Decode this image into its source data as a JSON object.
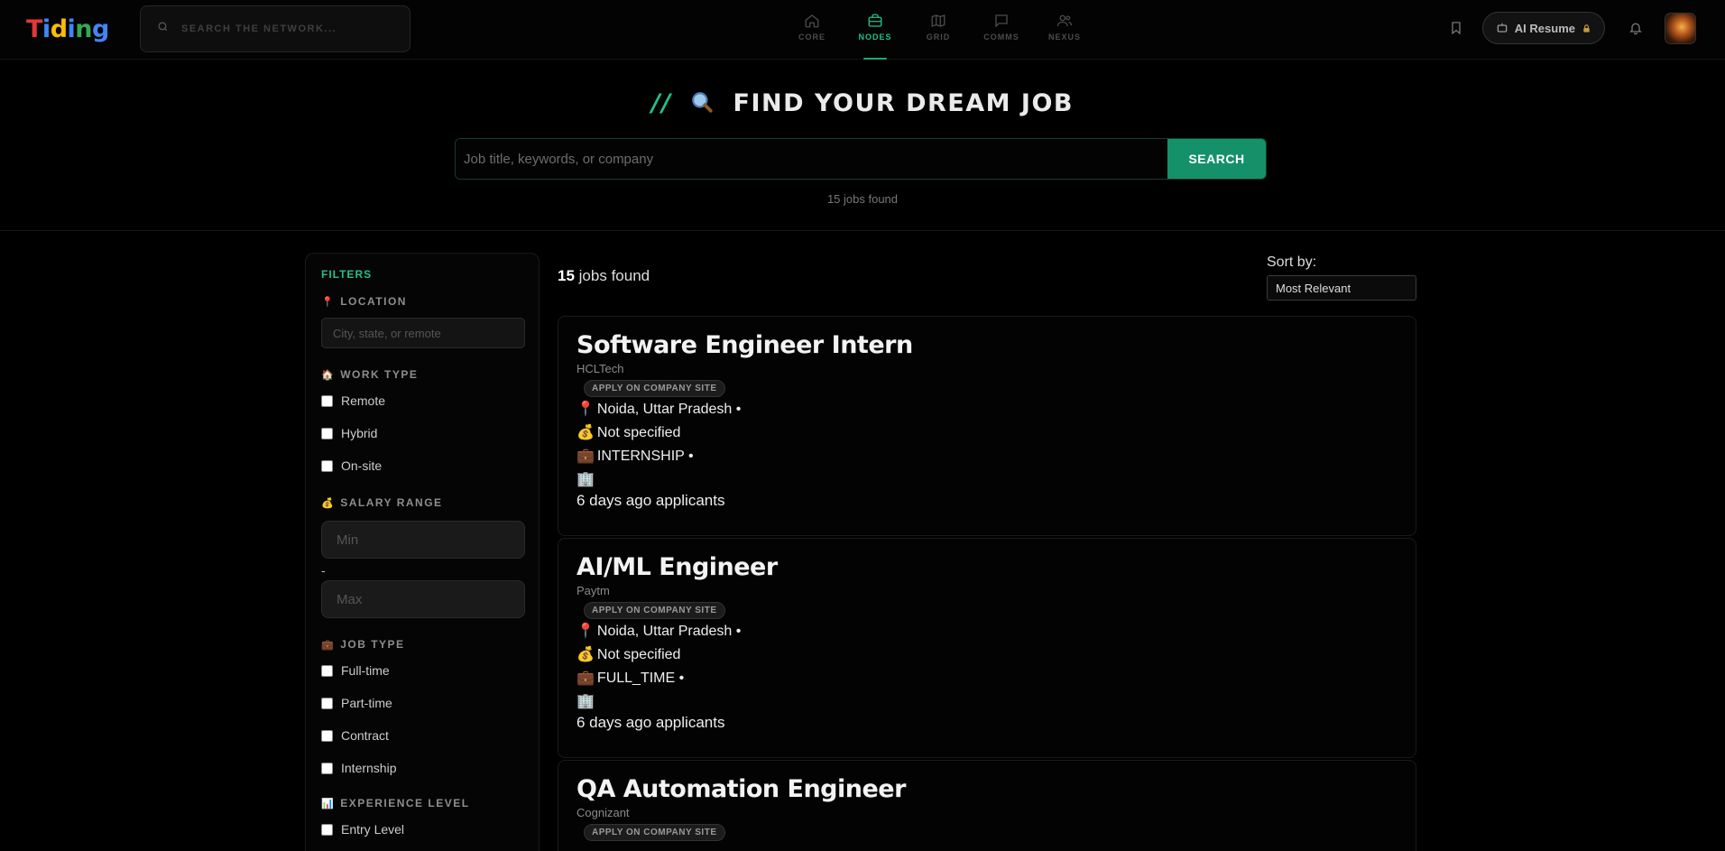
{
  "app": {
    "logo": [
      "T",
      "i",
      "d",
      "i",
      "n",
      "g"
    ]
  },
  "network_search": {
    "placeholder": "SEARCH THE NETWORK..."
  },
  "nav": [
    {
      "label": "CORE",
      "icon": "home-icon"
    },
    {
      "label": "NODES",
      "icon": "briefcase-icon",
      "active": true
    },
    {
      "label": "GRID",
      "icon": "map-icon"
    },
    {
      "label": "COMMS",
      "icon": "chat-icon"
    },
    {
      "label": "NEXUS",
      "icon": "users-icon"
    }
  ],
  "header_right": {
    "ai_resume_label": "AI Resume"
  },
  "hero": {
    "slashes": "//",
    "title": "FIND YOUR DREAM JOB",
    "search_placeholder": "Job title, keywords, or company",
    "search_button": "SEARCH",
    "jobs_found": "15 jobs found"
  },
  "filters": {
    "heading": "FILTERS",
    "location": {
      "label": "LOCATION",
      "placeholder": "City, state, or remote"
    },
    "work_type": {
      "label": "WORK TYPE",
      "options": [
        "Remote",
        "Hybrid",
        "On-site"
      ]
    },
    "salary": {
      "label": "SALARY RANGE",
      "min_placeholder": "Min",
      "dash": "-",
      "max_placeholder": "Max"
    },
    "job_type": {
      "label": "JOB TYPE",
      "options": [
        "Full-time",
        "Part-time",
        "Contract",
        "Internship"
      ]
    },
    "experience": {
      "label": "EXPERIENCE LEVEL",
      "options": [
        "Entry Level"
      ]
    }
  },
  "results": {
    "count": "15",
    "count_suffix": "jobs found",
    "sort_label": "Sort by:",
    "sort_value": "Most Relevant"
  },
  "jobs": [
    {
      "title": "Software Engineer Intern",
      "company": "HCLTech",
      "badge": "APPLY ON COMPANY SITE",
      "location": "Noida, Uttar Pradesh •",
      "salary": "Not specified",
      "type": "INTERNSHIP •",
      "posted": "6 days ago applicants"
    },
    {
      "title": "AI/ML Engineer",
      "company": "Paytm",
      "badge": "APPLY ON COMPANY SITE",
      "location": "Noida, Uttar Pradesh •",
      "salary": "Not specified",
      "type": "FULL_TIME •",
      "posted": "6 days ago applicants"
    },
    {
      "title": "QA Automation Engineer",
      "company": "Cognizant",
      "badge": "APPLY ON COMPANY SITE",
      "location": "",
      "salary": "",
      "type": "",
      "posted": ""
    }
  ],
  "colors": {
    "accent": "#22c08a",
    "button": "#15916a",
    "background": "#000000"
  }
}
